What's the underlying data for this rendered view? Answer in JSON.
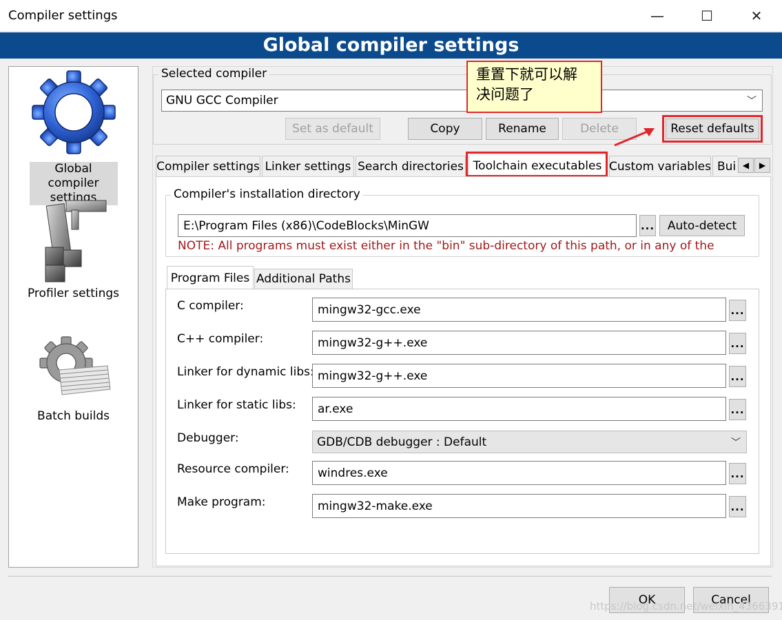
{
  "window": {
    "title": "Compiler settings",
    "minimize_glyph": "—",
    "maximize_glyph": "☐",
    "close_glyph": "✕"
  },
  "banner": {
    "title": "Global compiler settings"
  },
  "sidebar": {
    "items": [
      {
        "label": "Global compiler settings",
        "icon": "gear-icon",
        "selected": true
      },
      {
        "label": "Profiler settings",
        "icon": "caliper-icon",
        "selected": false
      },
      {
        "label": "Batch builds",
        "icon": "batch-gear-icon",
        "selected": false
      }
    ]
  },
  "compiler": {
    "group_label": "Selected compiler",
    "selected": "GNU GCC Compiler",
    "buttons": {
      "set_default": "Set as default",
      "copy": "Copy",
      "rename": "Rename",
      "delete": "Delete",
      "reset": "Reset defaults"
    }
  },
  "annotation": {
    "callout_line1": "重置下就可以解",
    "callout_line2": "决问题了",
    "highlight_color": "#e0262b"
  },
  "tabs": [
    {
      "label": "Compiler settings",
      "active": false
    },
    {
      "label": "Linker settings",
      "active": false
    },
    {
      "label": "Search directories",
      "active": false
    },
    {
      "label": "Toolchain executables",
      "active": true
    },
    {
      "label": "Custom variables",
      "active": false
    },
    {
      "label": "Bui",
      "active": false
    }
  ],
  "install": {
    "group_label": "Compiler's installation directory",
    "path": "E:\\Program Files (x86)\\CodeBlocks\\MinGW",
    "browse": "...",
    "autodetect": "Auto-detect",
    "note": "NOTE: All programs must exist either in the \"bin\" sub-directory of this path, or in any of the"
  },
  "subtabs": [
    {
      "label": "Program Files",
      "active": true
    },
    {
      "label": "Additional Paths",
      "active": false
    }
  ],
  "programs": {
    "c_compiler": {
      "label": "C compiler:",
      "value": "mingw32-gcc.exe"
    },
    "cpp_compiler": {
      "label": "C++ compiler:",
      "value": "mingw32-g++.exe"
    },
    "linker_dynamic": {
      "label": "Linker for dynamic libs:",
      "value": "mingw32-g++.exe"
    },
    "linker_static": {
      "label": "Linker for static libs:",
      "value": "ar.exe"
    },
    "debugger": {
      "label": "Debugger:",
      "value": "GDB/CDB debugger : Default"
    },
    "resource_compiler": {
      "label": "Resource compiler:",
      "value": "windres.exe"
    },
    "make": {
      "label": "Make program:",
      "value": "mingw32-make.exe"
    },
    "browse": "..."
  },
  "footer": {
    "ok": "OK",
    "cancel": "Cancel",
    "watermark": "https://blog.csdn.net/weixin_43663917"
  },
  "colors": {
    "banner_bg": "#0b4a8c",
    "note_text": "#a11818",
    "callout_bg": "#ffffcc"
  }
}
